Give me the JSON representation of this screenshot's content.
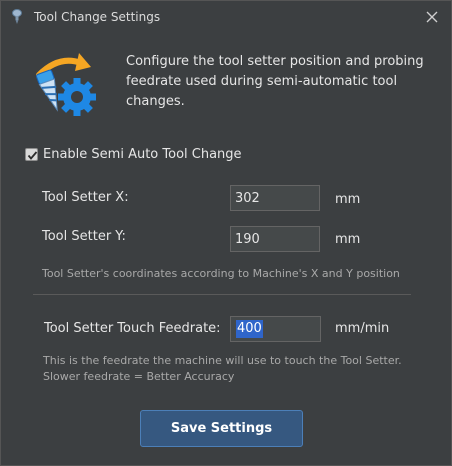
{
  "window": {
    "title": "Tool Change Settings",
    "title_icon": "probe-icon",
    "close_icon": "close-icon"
  },
  "header": {
    "icon": "tool-change-gear-icon",
    "description": "Configure the tool setter position and probing feedrate used during semi-automatic tool changes."
  },
  "enable_checkbox": {
    "label": "Enable Semi Auto Tool Change",
    "checked": true
  },
  "setter_x": {
    "label": "Tool Setter X:",
    "value": "302",
    "unit": "mm"
  },
  "setter_y": {
    "label": "Tool Setter Y:",
    "value": "190",
    "unit": "mm"
  },
  "coordinates_hint": "Tool Setter's coordinates according to Machine's X and Y position",
  "feedrate": {
    "label": "Tool Setter Touch Feedrate:",
    "value": "400",
    "unit": "mm/min"
  },
  "feedrate_hint": {
    "line1": "This is the feedrate the machine will use to touch the Tool Setter.",
    "line2": "Slower feedrate = Better Accuracy"
  },
  "save_button": {
    "label": "Save Settings"
  },
  "colors": {
    "background": "#3c3f41",
    "accent_button": "#365880",
    "selection": "#2f65ca",
    "arrow_orange": "#f5a623",
    "gear_blue": "#1e88e5"
  }
}
